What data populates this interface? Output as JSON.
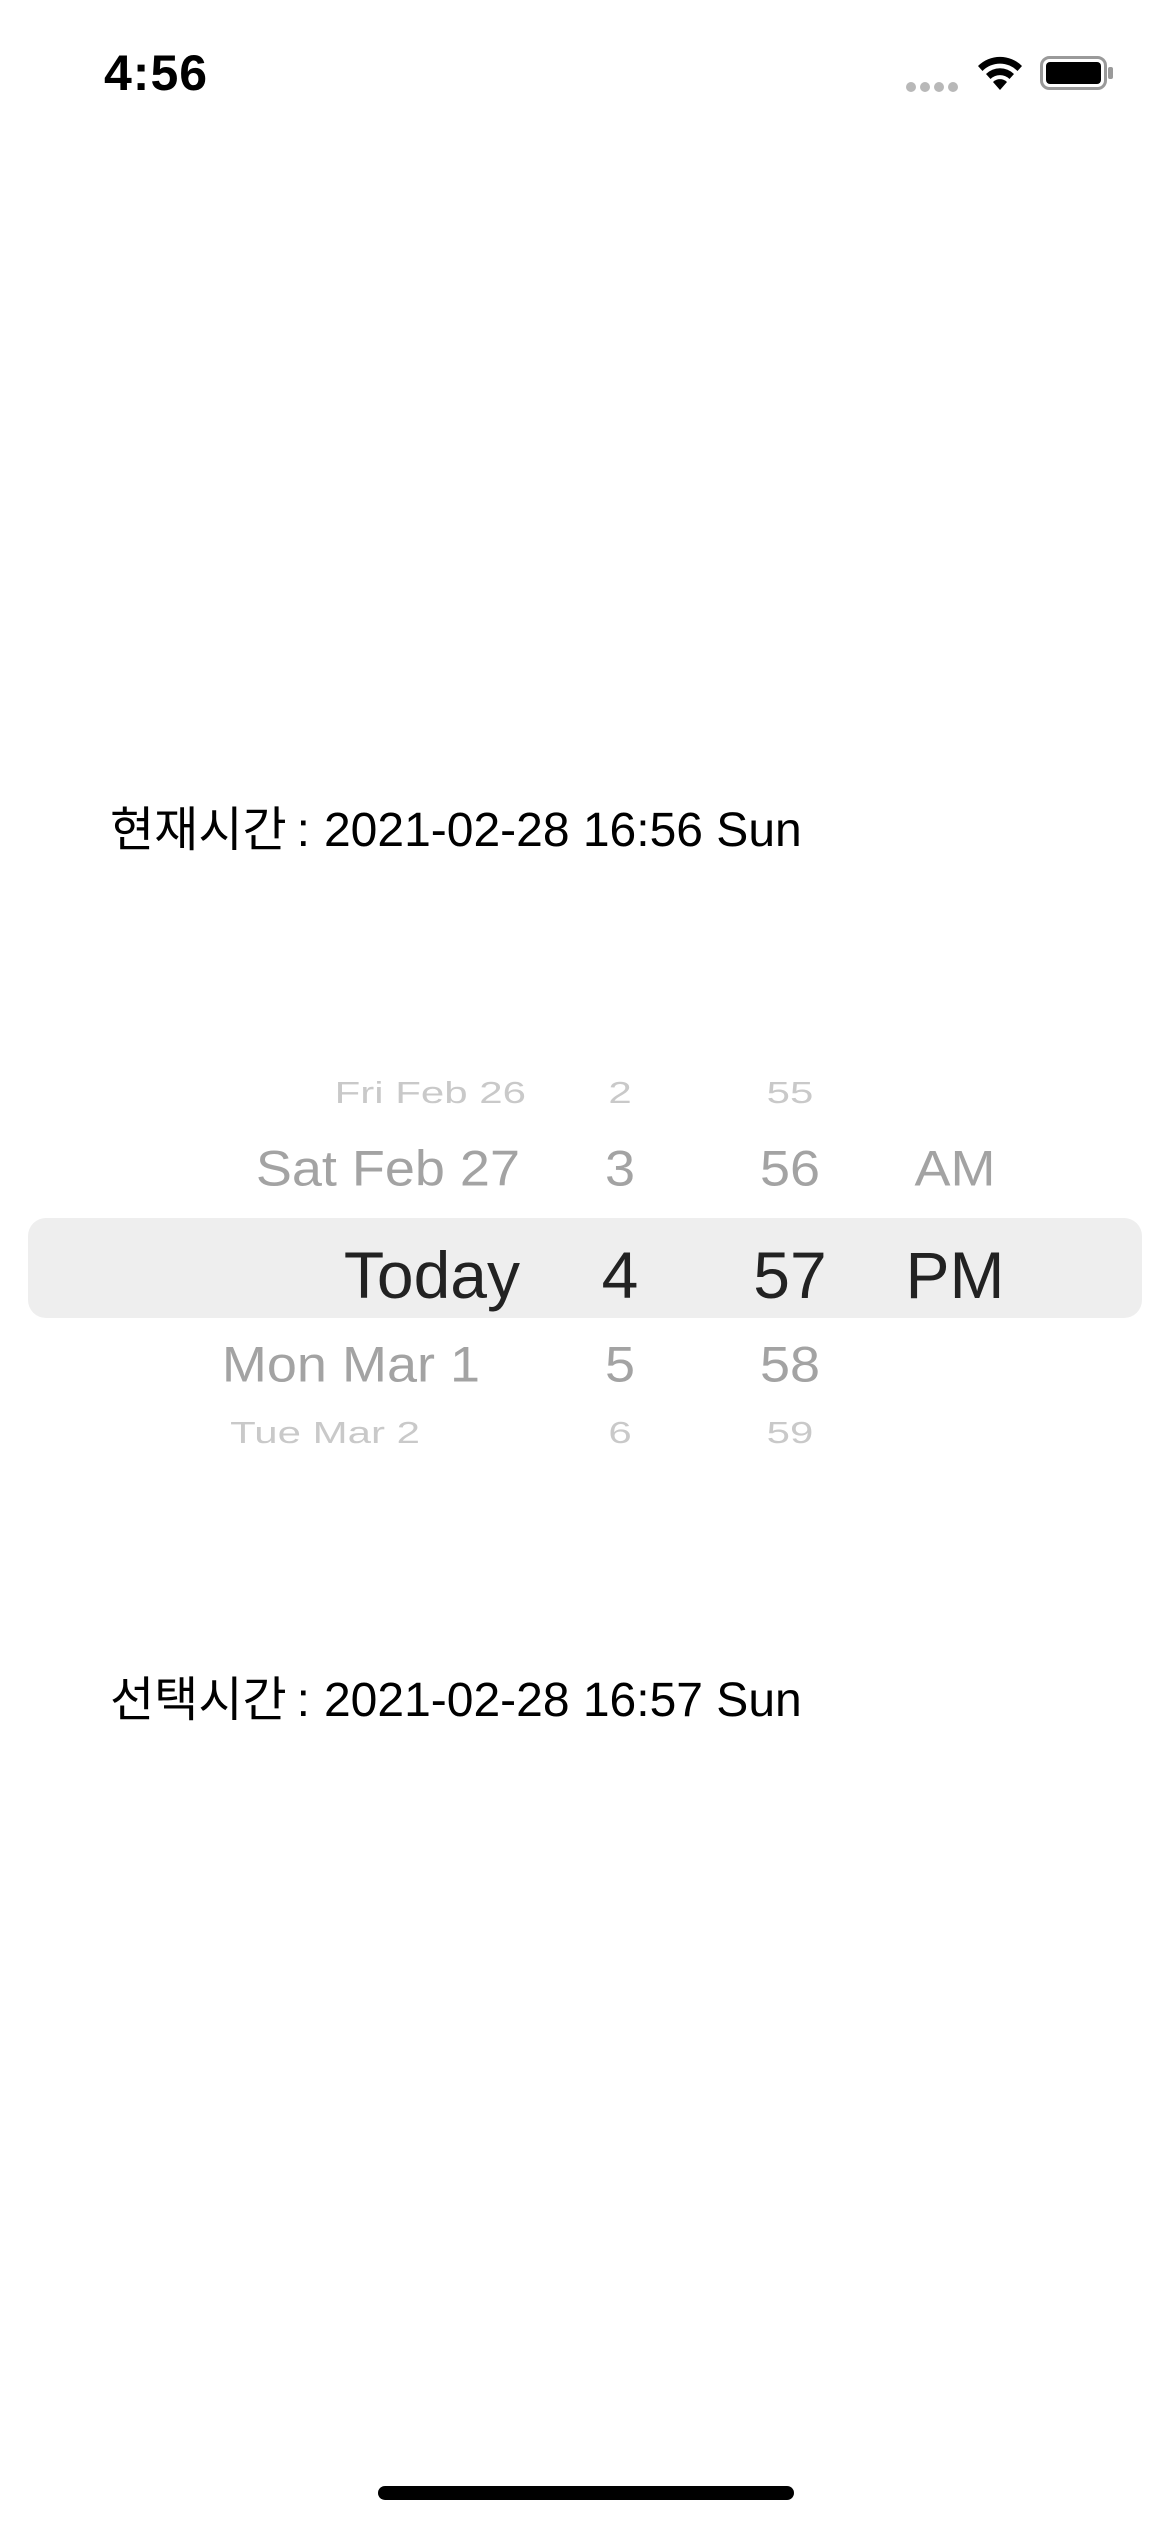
{
  "status_bar": {
    "time": "4:56",
    "signal_icon": "cellular-signal-icon",
    "wifi_icon": "wifi-icon",
    "battery_icon": "battery-full-icon"
  },
  "current_time": {
    "label": "현재시간",
    "separator": ":",
    "value": "2021-02-28 16:56 Sun"
  },
  "picker": {
    "date_column": [
      "Fri Feb 26",
      "Sat Feb 27",
      "Today",
      "Mon Mar 1",
      "Tue Mar 2"
    ],
    "hour_column": [
      "2",
      "3",
      "4",
      "5",
      "6"
    ],
    "minute_column": [
      "55",
      "56",
      "57",
      "58",
      "59"
    ],
    "ampm_column": [
      "AM",
      "PM"
    ],
    "selected": {
      "date": "Today",
      "hour": "4",
      "minute": "57",
      "ampm": "PM"
    }
  },
  "selected_time": {
    "label": "선택시간",
    "separator": ":",
    "value": "2021-02-28 16:57 Sun"
  }
}
